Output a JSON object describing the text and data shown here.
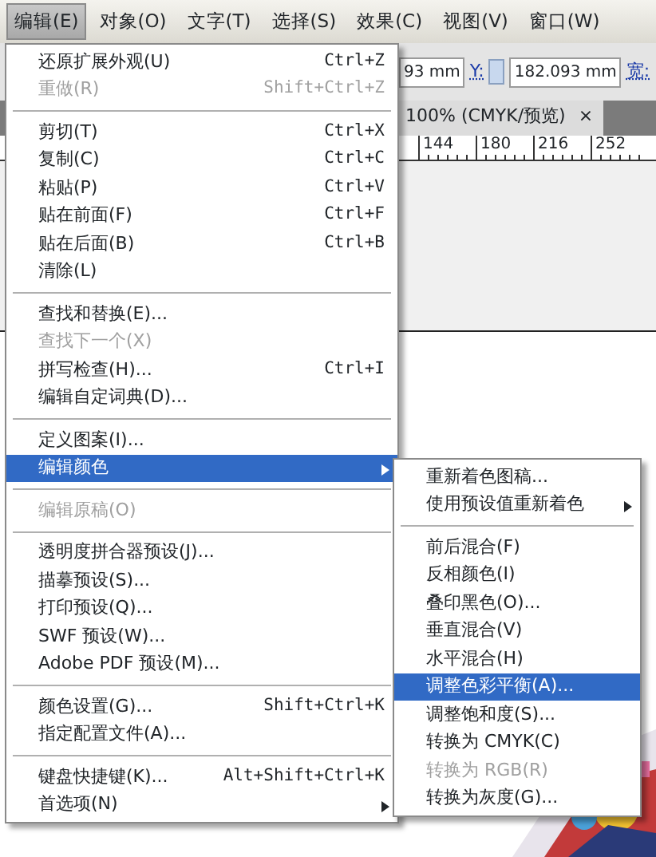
{
  "menubar": [
    {
      "label": "编辑(E)",
      "selected": true
    },
    {
      "label": "对象(O)",
      "selected": false
    },
    {
      "label": "文字(T)",
      "selected": false
    },
    {
      "label": "选择(S)",
      "selected": false
    },
    {
      "label": "效果(C)",
      "selected": false
    },
    {
      "label": "视图(V)",
      "selected": false
    },
    {
      "label": "窗口(W)",
      "selected": false
    }
  ],
  "control_bar": {
    "x_value": "93 mm",
    "y_label": "Y:",
    "y_value": "182.093 mm",
    "width_label": "宽:"
  },
  "document_tab": {
    "title": "100% (CMYK/预览)",
    "close": "×"
  },
  "ruler": [
    "144",
    "180",
    "216",
    "252"
  ],
  "menu": [
    {
      "kind": "item",
      "label": "还原扩展外观(U)",
      "shortcut": "Ctrl+Z",
      "disabled": false,
      "selected": false,
      "has_submenu": false
    },
    {
      "kind": "item",
      "label": "重做(R)",
      "shortcut": "Shift+Ctrl+Z",
      "disabled": true,
      "selected": false,
      "has_submenu": false
    },
    {
      "kind": "separator"
    },
    {
      "kind": "item",
      "label": "剪切(T)",
      "shortcut": "Ctrl+X",
      "disabled": false,
      "selected": false,
      "has_submenu": false
    },
    {
      "kind": "item",
      "label": "复制(C)",
      "shortcut": "Ctrl+C",
      "disabled": false,
      "selected": false,
      "has_submenu": false
    },
    {
      "kind": "item",
      "label": "粘贴(P)",
      "shortcut": "Ctrl+V",
      "disabled": false,
      "selected": false,
      "has_submenu": false
    },
    {
      "kind": "item",
      "label": "贴在前面(F)",
      "shortcut": "Ctrl+F",
      "disabled": false,
      "selected": false,
      "has_submenu": false
    },
    {
      "kind": "item",
      "label": "贴在后面(B)",
      "shortcut": "Ctrl+B",
      "disabled": false,
      "selected": false,
      "has_submenu": false
    },
    {
      "kind": "item",
      "label": "清除(L)",
      "disabled": false,
      "selected": false,
      "has_submenu": false
    },
    {
      "kind": "separator"
    },
    {
      "kind": "item",
      "label": "查找和替换(E)...",
      "disabled": false,
      "selected": false,
      "has_submenu": false
    },
    {
      "kind": "item",
      "label": "查找下一个(X)",
      "disabled": true,
      "selected": false,
      "has_submenu": false
    },
    {
      "kind": "item",
      "label": "拼写检查(H)...",
      "shortcut": "Ctrl+I",
      "disabled": false,
      "selected": false,
      "has_submenu": false
    },
    {
      "kind": "item",
      "label": "编辑自定词典(D)...",
      "disabled": false,
      "selected": false,
      "has_submenu": false
    },
    {
      "kind": "separator"
    },
    {
      "kind": "item",
      "label": "定义图案(I)...",
      "disabled": false,
      "selected": false,
      "has_submenu": false
    },
    {
      "kind": "item",
      "label": "编辑颜色",
      "disabled": false,
      "selected": true,
      "has_submenu": true
    },
    {
      "kind": "separator"
    },
    {
      "kind": "item",
      "label": "编辑原稿(O)",
      "disabled": true,
      "selected": false,
      "has_submenu": false
    },
    {
      "kind": "separator"
    },
    {
      "kind": "item",
      "label": "透明度拼合器预设(J)...",
      "disabled": false,
      "selected": false,
      "has_submenu": false
    },
    {
      "kind": "item",
      "label": "描摹预设(S)...",
      "disabled": false,
      "selected": false,
      "has_submenu": false
    },
    {
      "kind": "item",
      "label": "打印预设(Q)...",
      "disabled": false,
      "selected": false,
      "has_submenu": false
    },
    {
      "kind": "item",
      "label": "SWF 预设(W)...",
      "disabled": false,
      "selected": false,
      "has_submenu": false
    },
    {
      "kind": "item",
      "label": "Adobe PDF 预设(M)...",
      "disabled": false,
      "selected": false,
      "has_submenu": false
    },
    {
      "kind": "separator"
    },
    {
      "kind": "item",
      "label": "颜色设置(G)...",
      "shortcut": "Shift+Ctrl+K",
      "disabled": false,
      "selected": false,
      "has_submenu": false
    },
    {
      "kind": "item",
      "label": "指定配置文件(A)...",
      "disabled": false,
      "selected": false,
      "has_submenu": false
    },
    {
      "kind": "separator"
    },
    {
      "kind": "item",
      "label": "键盘快捷键(K)...",
      "shortcut": "Alt+Shift+Ctrl+K",
      "disabled": false,
      "selected": false,
      "has_submenu": false
    },
    {
      "kind": "item",
      "label": "首选项(N)",
      "disabled": false,
      "selected": false,
      "has_submenu": true
    }
  ],
  "submenu": [
    {
      "kind": "item",
      "label": "重新着色图稿...",
      "disabled": false,
      "selected": false,
      "has_submenu": false
    },
    {
      "kind": "item",
      "label": "使用预设值重新着色",
      "disabled": false,
      "selected": false,
      "has_submenu": true
    },
    {
      "kind": "separator"
    },
    {
      "kind": "item",
      "label": "前后混合(F)",
      "disabled": false,
      "selected": false,
      "has_submenu": false
    },
    {
      "kind": "item",
      "label": "反相颜色(I)",
      "disabled": false,
      "selected": false,
      "has_submenu": false
    },
    {
      "kind": "item",
      "label": "叠印黑色(O)...",
      "disabled": false,
      "selected": false,
      "has_submenu": false
    },
    {
      "kind": "item",
      "label": "垂直混合(V)",
      "disabled": false,
      "selected": false,
      "has_submenu": false
    },
    {
      "kind": "item",
      "label": "水平混合(H)",
      "disabled": false,
      "selected": false,
      "has_submenu": false
    },
    {
      "kind": "item",
      "label": "调整色彩平衡(A)...",
      "disabled": false,
      "selected": true,
      "has_submenu": false
    },
    {
      "kind": "item",
      "label": "调整饱和度(S)...",
      "disabled": false,
      "selected": false,
      "has_submenu": false
    },
    {
      "kind": "item",
      "label": "转换为 CMYK(C)",
      "disabled": false,
      "selected": false,
      "has_submenu": false
    },
    {
      "kind": "item",
      "label": "转换为 RGB(R)",
      "disabled": true,
      "selected": false,
      "has_submenu": false
    },
    {
      "kind": "item",
      "label": "转换为灰度(G)...",
      "disabled": false,
      "selected": false,
      "has_submenu": false
    }
  ]
}
